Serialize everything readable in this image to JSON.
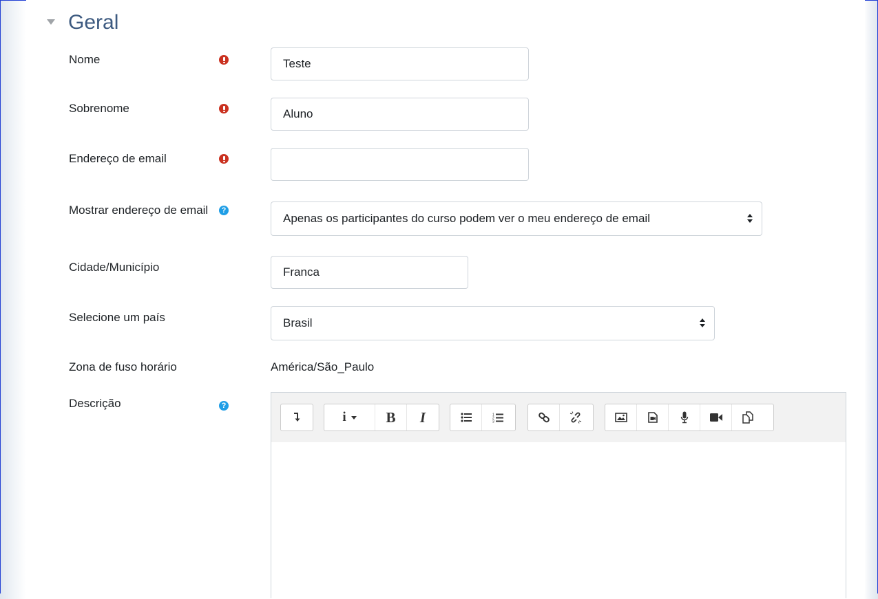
{
  "section": {
    "title": "Geral"
  },
  "fields": {
    "firstname": {
      "label": "Nome",
      "value": "Teste"
    },
    "lastname": {
      "label": "Sobrenome",
      "value": "Aluno"
    },
    "email": {
      "label": "Endereço de email",
      "value": ""
    },
    "maildisplay": {
      "label": "Mostrar endereço de email",
      "value": "Apenas os participantes do curso podem ver o meu endereço de email"
    },
    "city": {
      "label": "Cidade/Município",
      "value": "Franca"
    },
    "country": {
      "label": "Selecione um país",
      "value": "Brasil"
    },
    "timezone": {
      "label": "Zona de fuso horário",
      "value": "América/São_Paulo"
    },
    "description": {
      "label": "Descrição",
      "value": ""
    }
  },
  "icons": {
    "required": "exclamation-circle-icon",
    "help": "question-circle-icon"
  },
  "colors": {
    "required": "#ca3120",
    "help": "#1f9ee6",
    "legend": "#3d5a80"
  },
  "editor_toolbar": {
    "groups": [
      [
        "collapse-icon"
      ],
      [
        "paragraph-style-icon",
        "bold-icon",
        "italic-icon"
      ],
      [
        "unordered-list-icon",
        "ordered-list-icon"
      ],
      [
        "link-icon",
        "unlink-icon"
      ],
      [
        "image-icon",
        "media-icon",
        "record-audio-icon",
        "record-video-icon",
        "manage-files-icon"
      ]
    ]
  }
}
